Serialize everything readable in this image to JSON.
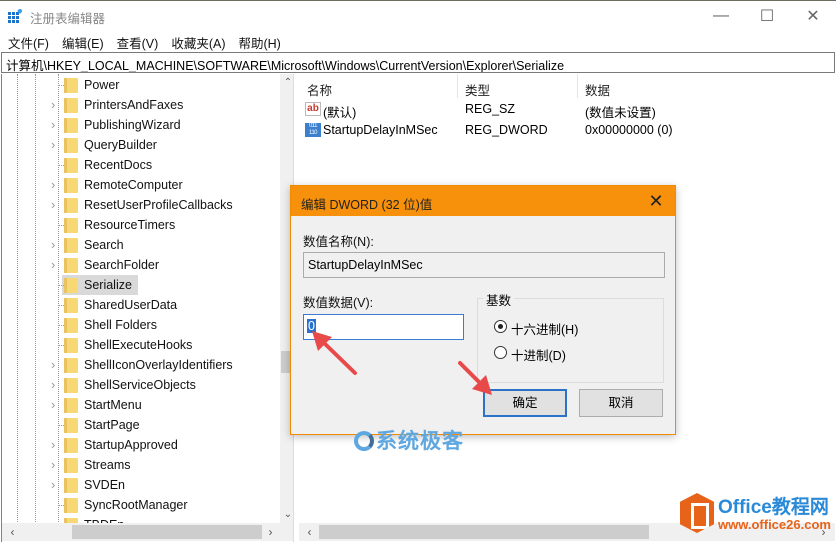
{
  "window": {
    "title": "注册表编辑器",
    "min_glyph": "—",
    "max_glyph": "☐",
    "close_glyph": "✕"
  },
  "menu": [
    {
      "label": "文件(F)"
    },
    {
      "label": "编辑(E)"
    },
    {
      "label": "查看(V)"
    },
    {
      "label": "收藏夹(A)"
    },
    {
      "label": "帮助(H)"
    }
  ],
  "address": {
    "path": "计算机\\HKEY_LOCAL_MACHINE\\SOFTWARE\\Microsoft\\Windows\\CurrentVersion\\Explorer\\Serialize"
  },
  "tree": {
    "items": [
      {
        "label": "Power",
        "expandable": false
      },
      {
        "label": "PrintersAndFaxes",
        "expandable": true
      },
      {
        "label": "PublishingWizard",
        "expandable": true
      },
      {
        "label": "QueryBuilder",
        "expandable": true
      },
      {
        "label": "RecentDocs",
        "expandable": false
      },
      {
        "label": "RemoteComputer",
        "expandable": true
      },
      {
        "label": "ResetUserProfileCallbacks",
        "expandable": true
      },
      {
        "label": "ResourceTimers",
        "expandable": false
      },
      {
        "label": "Search",
        "expandable": true
      },
      {
        "label": "SearchFolder",
        "expandable": true
      },
      {
        "label": "Serialize",
        "expandable": false,
        "selected": true
      },
      {
        "label": "SharedUserData",
        "expandable": false
      },
      {
        "label": "Shell Folders",
        "expandable": false
      },
      {
        "label": "ShellExecuteHooks",
        "expandable": false
      },
      {
        "label": "ShellIconOverlayIdentifiers",
        "expandable": true
      },
      {
        "label": "ShellServiceObjects",
        "expandable": true
      },
      {
        "label": "StartMenu",
        "expandable": true
      },
      {
        "label": "StartPage",
        "expandable": false
      },
      {
        "label": "StartupApproved",
        "expandable": true
      },
      {
        "label": "Streams",
        "expandable": true
      },
      {
        "label": "SVDEn",
        "expandable": true
      },
      {
        "label": "SyncRootManager",
        "expandable": false
      },
      {
        "label": "TBDEn",
        "expandable": false
      }
    ],
    "chevron_glyph": "›",
    "scroll_up": "⌃",
    "scroll_down": "⌄",
    "scroll_left": "‹",
    "scroll_right": "›"
  },
  "list": {
    "columns": [
      "名称",
      "类型",
      "数据"
    ],
    "rows": [
      {
        "icon": "string-value-icon",
        "name": "(默认)",
        "type": "REG_SZ",
        "data": "(数值未设置)"
      },
      {
        "icon": "binary-value-icon",
        "name": "StartupDelayInMSec",
        "type": "REG_DWORD",
        "data": "0x00000000 (0)"
      }
    ],
    "scroll_left": "‹",
    "scroll_right": "›"
  },
  "dialog": {
    "title": "编辑 DWORD (32 位)值",
    "close_glyph": "✕",
    "value_name_label": "数值名称(N):",
    "value_name": "StartupDelayInMSec",
    "value_data_label": "数值数据(V):",
    "value_data": "0",
    "base_label": "基数",
    "base_options": [
      {
        "label": "十六进制(H)",
        "checked": true
      },
      {
        "label": "十进制(D)",
        "checked": false
      }
    ],
    "ok_label": "确定",
    "cancel_label": "取消"
  },
  "watermarks": {
    "site1": "系统极客",
    "site2_title": "Office教程网",
    "site2_url": "www.office26.com"
  },
  "colors": {
    "dialog_accent": "#f7900a",
    "selection_blue": "#2a71d0",
    "annotation_arrow": "#e84a4a"
  }
}
